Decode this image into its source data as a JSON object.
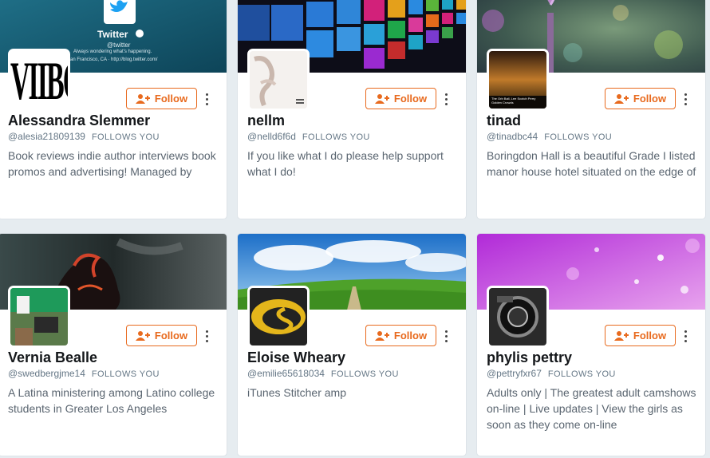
{
  "follow_label": "Follow",
  "follows_you_label": "FOLLOWS YOU",
  "banner_twitter": {
    "title": "Twitter",
    "handle": "@twitter",
    "tagline": "Always wondering what's happening.",
    "location_url": "San Francisco, CA · http://blog.twitter.com/"
  },
  "avatar_texts": {
    "viibo": "VIIBO",
    "tinad_caption": "The Orb Ball, Lee Scotch Perry Golden Crowds"
  },
  "cards": [
    {
      "name": "Alessandra Slemmer",
      "handle": "@alesia21809139",
      "bio": "Book reviews indie author interviews book promos and advertising! Managed by"
    },
    {
      "name": "nellm",
      "handle": "@nelld6f6d",
      "bio": "If you like what I do please help support what I do!"
    },
    {
      "name": "tinad",
      "handle": "@tinadbc44",
      "bio": "Boringdon Hall is a beautiful Grade I listed manor house hotel situated on the edge of"
    },
    {
      "name": "Vernia Bealle",
      "handle": "@swedbergjme14",
      "bio": "A Latina ministering among Latino college students in Greater Los Angeles"
    },
    {
      "name": "Eloise Wheary",
      "handle": "@emilie65618034",
      "bio": "iTunes Stitcher amp"
    },
    {
      "name": "phylis pettry",
      "handle": "@pettryfxr67",
      "bio": "Adults only | The greatest adult camshows on-line | Live updates | View the girls as soon as they come on-line"
    }
  ],
  "colors": {
    "accent": "#e86a1e",
    "name": "#14171a",
    "meta": "#657786"
  },
  "icons": {
    "follow": "add-user-icon",
    "more": "vertical-ellipsis-icon"
  }
}
